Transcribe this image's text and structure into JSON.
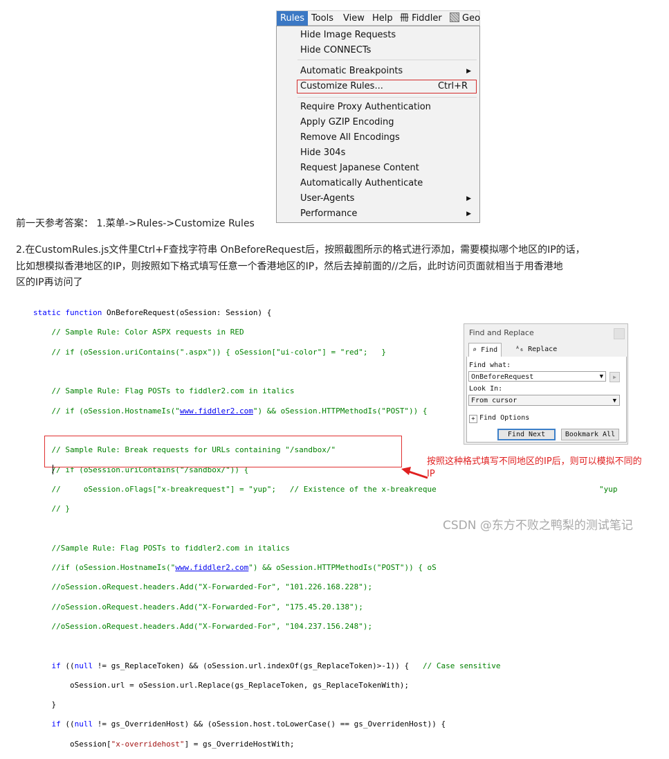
{
  "menu": {
    "bar": [
      "Rules",
      "Tools",
      "View",
      "Help",
      "Fiddler",
      "Geo"
    ],
    "bar_icons": [
      "",
      "",
      "",
      "",
      "fiddler-grid-icon",
      "geo-grid-icon"
    ],
    "bar_extra": "冊",
    "items": [
      {
        "label": "Hide Image Requests"
      },
      {
        "label": "Hide CONNECTs"
      },
      {
        "label": "Automatic Breakpoints",
        "submenu": "▶"
      },
      {
        "label": "Customize Rules...",
        "shortcut": "Ctrl+R"
      },
      {
        "label": "Require Proxy Authentication"
      },
      {
        "label": "Apply GZIP Encoding"
      },
      {
        "label": "Remove All Encodings"
      },
      {
        "label": "Hide 304s"
      },
      {
        "label": "Request Japanese Content"
      },
      {
        "label": "Automatically Authenticate"
      },
      {
        "label": "User-Agents",
        "submenu": "▶"
      },
      {
        "label": "Performance",
        "submenu": "▶"
      }
    ]
  },
  "text": {
    "para1": "前一天参考答案： 1.菜单->Rules->Customize Rules",
    "para2_line1": "2.在CustomRules.js文件里Ctrl+F查找字符串 OnBeforeRequest后，按照截图所示的格式进行添加，需要模拟哪个地区的IP的话，",
    "para2_line2": "比如想模拟香港地区的IP，则按照如下格式填写任意一个香港地区的IP，然后去掉前面的//之后，此时访问页面就相当于用香港地",
    "para2_line3": "区的IP再访问了"
  },
  "code": {
    "l01_kw1": "static function",
    "l01_rest": " OnBeforeRequest(oSession: Session) {",
    "l02": "    // Sample Rule: Color ASPX requests in RED",
    "l03": "    // if (oSession.uriContains(\".aspx\")) { oSession[\"ui-color\"] = \"red\";   }",
    "l05": "    // Sample Rule: Flag POSTs to fiddler2.com in italics",
    "l06a": "    // if (oSession.HostnameIs(\"",
    "l06link": "www.fiddler2.com",
    "l06b": "\") && oSession.HTTPMethodIs(\"POST\")) {",
    "l08": "    // Sample Rule: Break requests for URLs containing \"/sandbox/\"",
    "l09": "    // if (oSession.uriContains(\"/sandbox/\")) {",
    "l10a": "    //     oSession.oFlags[\"x-breakrequest\"] = \"yup\";   // Existence of the x-breakreque",
    "l10b": "\"yup",
    "l11": "    // }",
    "l13": "    //Sample Rule: Flag POSTs to fiddler2.com in italics",
    "l14a": "    //if (oSession.HostnameIs(\"",
    "l14link": "www.fiddler2.com",
    "l14b": "\") && oSession.HTTPMethodIs(\"POST\")) { oS",
    "l15": "    //oSession.oRequest.headers.Add(\"X-Forwarded-For\", \"101.226.168.228\");",
    "l16": "    //oSession.oRequest.headers.Add(\"X-Forwarded-For\", \"175.45.20.138\");",
    "l17": "    //oSession.oRequest.headers.Add(\"X-Forwarded-For\", \"104.237.156.248\");",
    "l19_pre": "    ",
    "l19_kw": "if",
    "l19_mid": " ((",
    "l19_null": "null",
    "l19_rest": " != gs_ReplaceToken) && (oSession.url.indexOf(gs_ReplaceToken)>-1)) {",
    "l19_cm": "   // Case sensitive",
    "l20": "        oSession.url = oSession.url.Replace(gs_ReplaceToken, gs_ReplaceTokenWith);",
    "l21": "    }",
    "l22_pre": "    ",
    "l22_kw": "if",
    "l22_mid": " ((",
    "l22_null": "null",
    "l22_rest": " != gs_OverridenHost) && (oSession.host.toLowerCase() == gs_OverridenHost)) {",
    "l23_pre": "        oSession[",
    "l23_str": "\"x-overridehost\"",
    "l23_rest": "] = gs_OverrideHostWith;"
  },
  "dialog": {
    "title": "Find and Replace",
    "tab_find": "Find",
    "tab_replace": "Replace",
    "find_label": "Find what:",
    "find_value": "OnBeforeRequest",
    "look_label": "Look In:",
    "look_value": "From cursor",
    "options_label": "Find Options",
    "find_next": "Find Next",
    "bookmark_all": "Bookmark All"
  },
  "annotation": "按照这种格式填写不同地区的IP后，则可以模拟不同的IP",
  "watermark": "CSDN @东方不败之鸭梨的测试笔记",
  "colors": {
    "keyword": "#0000ff",
    "comment": "#008000",
    "string": "#a31515",
    "highlight": "#e03030",
    "menu_active": "#3b78c4"
  }
}
